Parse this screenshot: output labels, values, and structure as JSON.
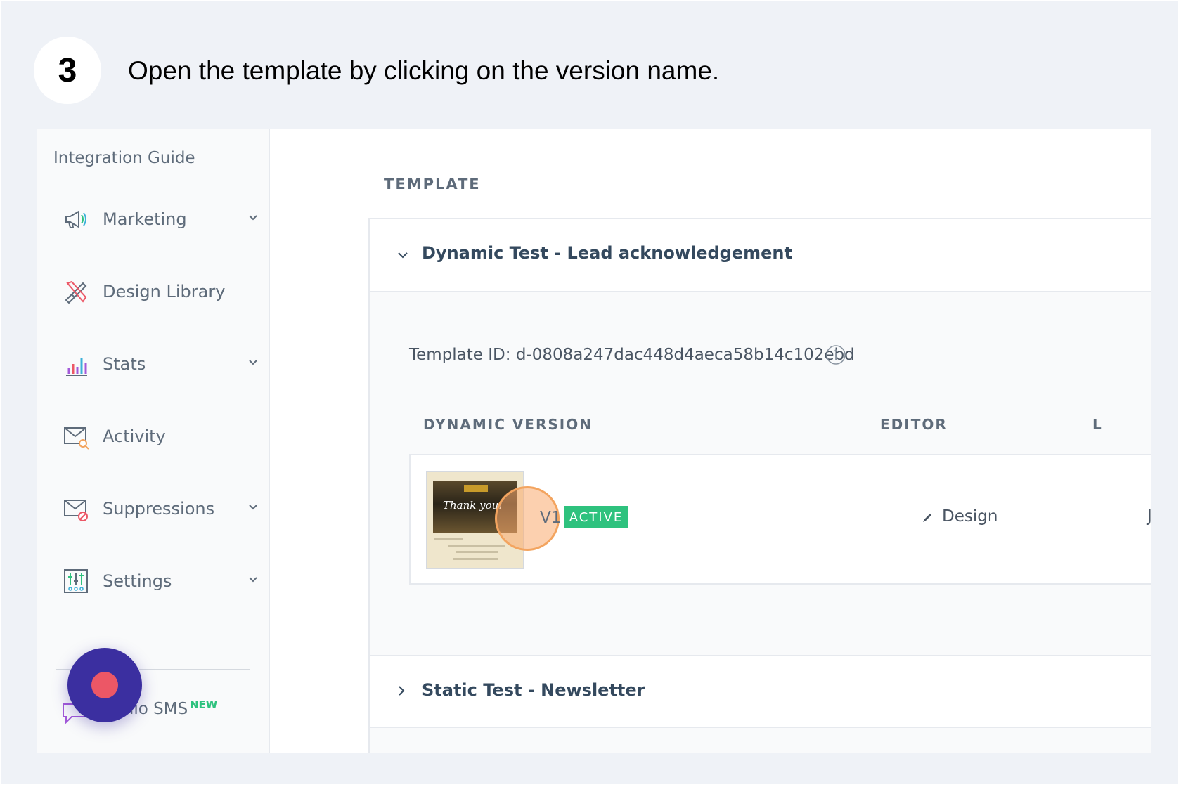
{
  "step": {
    "number": "3",
    "instruction": "Open the template by clicking on the version name."
  },
  "sidebar": {
    "integration_guide": "Integration Guide",
    "items": [
      {
        "label": "Marketing",
        "icon": "megaphone-icon",
        "has_chevron": true
      },
      {
        "label": "Design Library",
        "icon": "design-tools-icon",
        "has_chevron": false
      },
      {
        "label": "Stats",
        "icon": "bar-chart-icon",
        "has_chevron": true
      },
      {
        "label": "Activity",
        "icon": "mail-search-icon",
        "has_chevron": false
      },
      {
        "label": "Suppressions",
        "icon": "mail-blocked-icon",
        "has_chevron": true
      },
      {
        "label": "Settings",
        "icon": "sliders-icon",
        "has_chevron": true
      }
    ],
    "sms_label": "lio SMS",
    "new_badge": "NEW"
  },
  "main": {
    "section_title": "TEMPLATE",
    "template": {
      "name": "Dynamic Test - Lead acknowledgement",
      "template_id": "Template ID: d-0808a247dac448d4aeca58b14c102ebd",
      "columns": [
        "DYNAMIC VERSION",
        "EDITOR",
        "L"
      ],
      "version": {
        "thumbnail_text": "Thank you!",
        "name": "V1",
        "status": "ACTIVE",
        "editor": "Design",
        "last_partial": "J"
      }
    },
    "second_template": {
      "name": "Static Test - Newsletter"
    }
  },
  "colors": {
    "background": "#eff2f7",
    "active_green": "#2ec27e",
    "highlight_orange": "#f3a45f",
    "record_button": "#3b2fa0",
    "record_dot": "#ec5766"
  }
}
